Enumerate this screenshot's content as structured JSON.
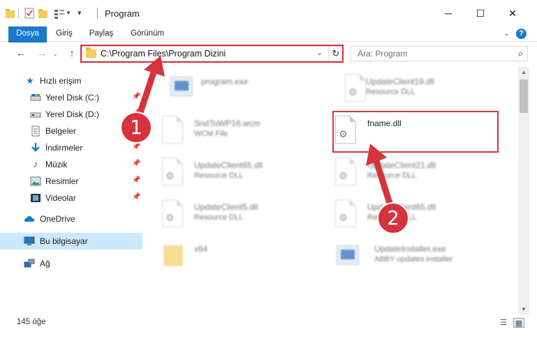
{
  "window": {
    "title": "Program",
    "minimize": "─",
    "maximize": "☐",
    "close": "✕"
  },
  "ribbon": {
    "tabs": [
      "Dosya",
      "Giriş",
      "Paylaş",
      "Görünüm"
    ],
    "help": "?"
  },
  "navigation": {
    "back": "←",
    "forward": "→",
    "up": "↑",
    "address": "C:\\Program Files\\Program Dizini",
    "refresh": "↻",
    "search_placeholder": "Ara: Program"
  },
  "sidebar": {
    "items": [
      {
        "label": "Hızlı erişim",
        "icon": "star-icon",
        "pinned": false
      },
      {
        "label": "Yerel Disk (C:)",
        "icon": "drive-icon",
        "pinned": true
      },
      {
        "label": "Yerel Disk (D:)",
        "icon": "drive-icon",
        "pinned": true
      },
      {
        "label": "Belgeler",
        "icon": "documents-icon",
        "pinned": true
      },
      {
        "label": "İndirmeler",
        "icon": "download-icon",
        "pinned": true
      },
      {
        "label": "Müzik",
        "icon": "music-icon",
        "pinned": true
      },
      {
        "label": "Resimler",
        "icon": "pictures-icon",
        "pinned": true
      },
      {
        "label": "Videolar",
        "icon": "videos-icon",
        "pinned": true
      },
      {
        "label": "OneDrive",
        "icon": "cloud-icon",
        "pinned": false
      },
      {
        "label": "Bu bilgisayar",
        "icon": "computer-icon",
        "pinned": false,
        "selected": true
      },
      {
        "label": "Ağ",
        "icon": "network-icon",
        "pinned": false
      }
    ]
  },
  "files": [
    {
      "name": "program.exe",
      "type": "",
      "icon": "exe-icon"
    },
    {
      "name": "UpdateClient19.dll",
      "type": "Resource DLL",
      "icon": "dll-icon"
    },
    {
      "name": "SndToWP16.wcm",
      "type": "WCM File",
      "icon": "file-icon"
    },
    {
      "name": "fname.dll",
      "type": "",
      "icon": "dll-icon",
      "highlighted": true
    },
    {
      "name": "UpdateClient65.dll",
      "type": "Resource DLL",
      "icon": "dll-icon"
    },
    {
      "name": "UpdateClient21.dll",
      "type": "Resource DLL",
      "icon": "dll-icon"
    },
    {
      "name": "UpdateClient5.dll",
      "type": "Resource DLL",
      "icon": "dll-icon"
    },
    {
      "name": "UpdateClient65.dll",
      "type": "Resource DLL",
      "icon": "dll-icon"
    },
    {
      "name": "x64",
      "type": "",
      "icon": "folder-icon"
    },
    {
      "name": "UpdateInstaller.exe",
      "type": "ABBY updates installer",
      "icon": "installer-icon"
    }
  ],
  "status": {
    "count": "145 öğe"
  },
  "annotations": {
    "step1": "1",
    "step2": "2",
    "color": "#d5343d"
  }
}
